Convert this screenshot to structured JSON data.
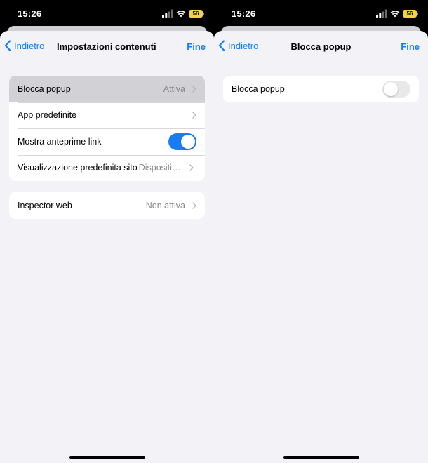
{
  "status_bar": {
    "time": "15:26",
    "battery": "56"
  },
  "colors": {
    "accent": "#1a7cf5",
    "toggle_on": "#1a7cf5",
    "toggle_off": "#e9e9ea",
    "battery": "#f5d33c"
  },
  "left_screen": {
    "nav": {
      "back_label": "Indietro",
      "title": "Impostazioni contenuti",
      "done_label": "Fine"
    },
    "group1": [
      {
        "label": "Blocca popup",
        "value": "Attiva"
      },
      {
        "label": "App predefinite",
        "value": ""
      },
      {
        "label": "Mostra anteprime link",
        "toggle": "on"
      },
      {
        "label": "Visualizzazione predefinita sito",
        "value": "Dispositivo mobile"
      }
    ],
    "group2": [
      {
        "label": "Inspector web",
        "value": "Non attiva"
      }
    ]
  },
  "right_screen": {
    "nav": {
      "back_label": "Indietro",
      "title": "Blocca popup",
      "done_label": "Fine"
    },
    "group1": [
      {
        "label": "Blocca popup",
        "toggle": "off"
      }
    ]
  }
}
